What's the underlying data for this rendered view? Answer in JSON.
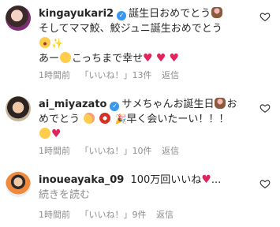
{
  "comments": [
    {
      "username": "kingayukari2",
      "segments": [
        "誕生日おめでとう",
        "そしてママ鮫、鮫ジュニ誕生おめでとう",
        "あー",
        "こっちまで幸せ"
      ],
      "time": "1時間前",
      "likes": "「いいね！」13件",
      "reply": "返信"
    },
    {
      "username": "ai_miyazato",
      "segments": [
        "サメちゃんお誕生日",
        "お",
        "めでとう",
        "早く会いたーい！！！"
      ],
      "time": "1時間前",
      "likes": "「いいね！」10件",
      "reply": "返信"
    },
    {
      "username": "inoueayaka_09",
      "segments": [
        "100万回いいね",
        "..."
      ],
      "more": "続きを読む",
      "time": "1時間前",
      "likes": "「いいね！」9件",
      "reply": "返信"
    }
  ],
  "icons": {
    "like": "heart-outline-icon",
    "verified": "verified-badge-icon"
  },
  "colors": {
    "text": "#262626",
    "secondary": "#8e8e8e",
    "verified": "#3897f0",
    "heart": "#e0245e"
  }
}
